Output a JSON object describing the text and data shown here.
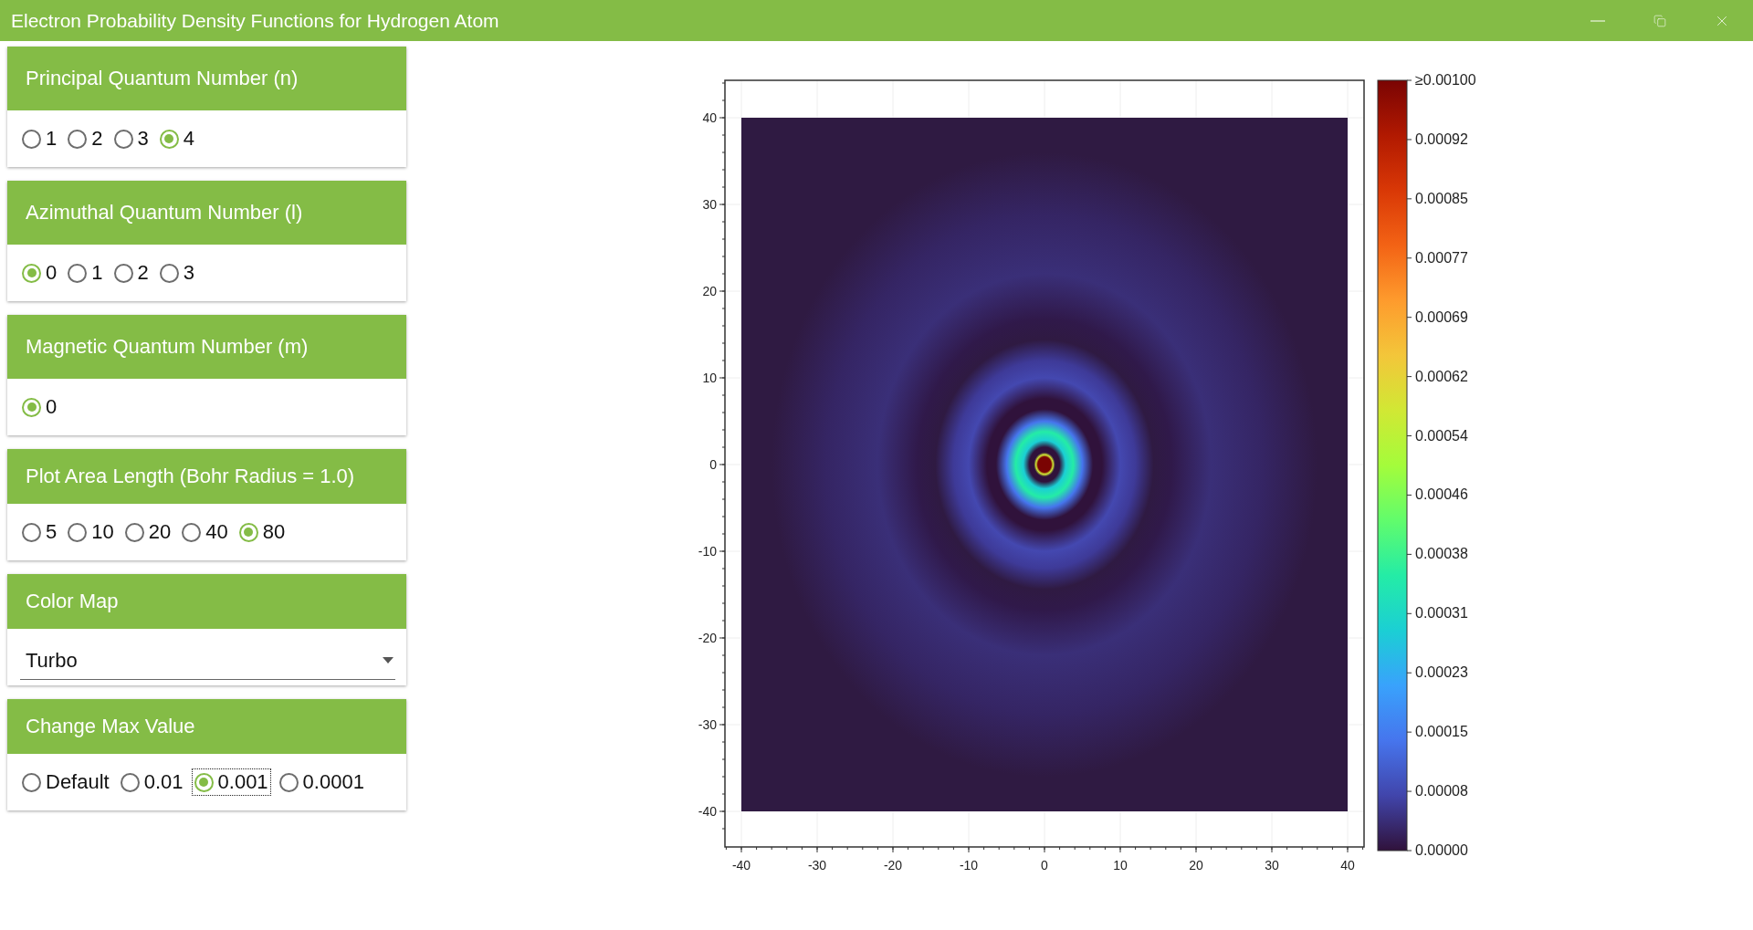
{
  "window": {
    "title": "Electron Probability Density Functions for Hydrogen Atom"
  },
  "panels": [
    {
      "title": "Principal Quantum Number (n)",
      "kind": "radio",
      "options": [
        {
          "label": "1",
          "selected": false
        },
        {
          "label": "2",
          "selected": false
        },
        {
          "label": "3",
          "selected": false
        },
        {
          "label": "4",
          "selected": true
        }
      ]
    },
    {
      "title": "Azimuthal Quantum Number (l)",
      "kind": "radio",
      "options": [
        {
          "label": "0",
          "selected": true
        },
        {
          "label": "1",
          "selected": false
        },
        {
          "label": "2",
          "selected": false
        },
        {
          "label": "3",
          "selected": false
        }
      ]
    },
    {
      "title": "Magnetic Quantum Number (m)",
      "kind": "radio",
      "options": [
        {
          "label": "0",
          "selected": true
        }
      ]
    },
    {
      "title": "Plot Area Length (Bohr Radius = 1.0)",
      "kind": "radio",
      "options": [
        {
          "label": "5",
          "selected": false
        },
        {
          "label": "10",
          "selected": false
        },
        {
          "label": "20",
          "selected": false
        },
        {
          "label": "40",
          "selected": false
        },
        {
          "label": "80",
          "selected": true
        }
      ]
    },
    {
      "title": "Color Map",
      "kind": "dropdown",
      "value": "Turbo"
    },
    {
      "title": "Change Max Value",
      "kind": "radio",
      "options": [
        {
          "label": "Default",
          "selected": false,
          "focused": false
        },
        {
          "label": "0.01",
          "selected": false,
          "focused": false
        },
        {
          "label": "0.001",
          "selected": true,
          "focused": true
        },
        {
          "label": "0.0001",
          "selected": false,
          "focused": false
        }
      ]
    }
  ],
  "plot": {
    "y_ticks": [
      "40",
      "30",
      "20",
      "10",
      "0",
      "-10",
      "-20",
      "-30",
      "-40"
    ],
    "x_ticks": [
      "-40",
      "-30",
      "-20",
      "-10",
      "0",
      "10",
      "20",
      "30",
      "40"
    ],
    "colorbar_labels": [
      "≥0.00100",
      "0.00092",
      "0.00085",
      "0.00077",
      "0.00069",
      "0.00062",
      "0.00054",
      "0.00046",
      "0.00038",
      "0.00031",
      "0.00023",
      "0.00015",
      "0.00008",
      "0.00000"
    ]
  }
}
